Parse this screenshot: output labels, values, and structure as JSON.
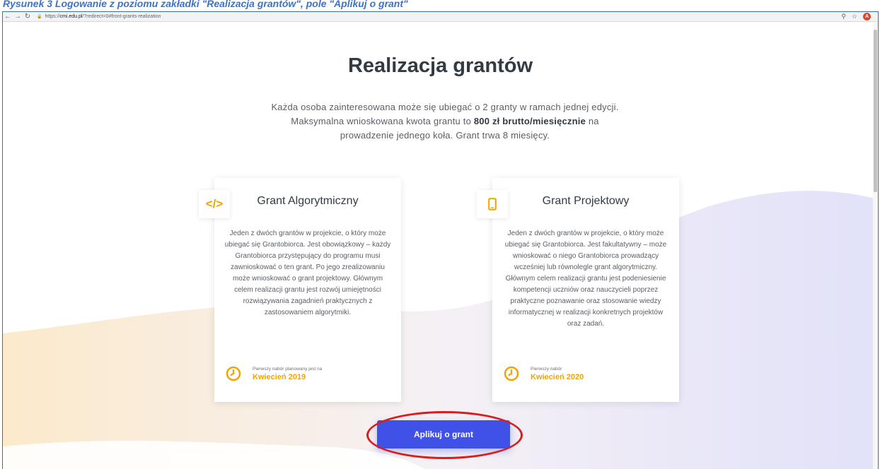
{
  "caption": "Rysunek 3 Logowanie z poziomu zakładki \"Realizacja grantów\", pole \"Aplikuj o grant\"",
  "browser": {
    "url_prefix": "https://",
    "url_domain": "cmi.edu.pl",
    "url_path": "/?redirect=0#front-grants-realization",
    "avatar_letter": "A"
  },
  "page": {
    "title": "Realizacja grantów",
    "intro_line1": "Każda osoba zainteresowana może się ubiegać o 2 granty w ramach jednej edycji.",
    "intro_line2_pre": "Maksymalna wnioskowana kwota grantu to ",
    "intro_line2_bold": "800 zł brutto/miesięcznie",
    "intro_line2_post": " na",
    "intro_line3": "prowadzenie jednego koła. Grant trwa 8 miesięcy."
  },
  "cards": [
    {
      "icon": "code-icon",
      "icon_glyph": "</>",
      "title": "Grant Algorytmiczny",
      "body": "Jeden z dwóch grantów w projekcie, o który może ubiegać się Grantobiorca. Jest obowiązkowy – każdy Grantobiorca przystępujący do programu musi zawnioskować o ten grant. Po jego zrealizowaniu może wnioskować o grant projektowy.  Głównym celem realizacji grantu jest rozwój umiejętności rozwiązywania zagadnień praktycznych z zastosowaniem algorytmiki.",
      "recruit_label": "Pierwszy nabór planowany jest na",
      "recruit_date": "Kwiecień 2019"
    },
    {
      "icon": "tablet-icon",
      "title": "Grant Projektowy",
      "body": "Jeden z dwóch grantów w projekcie, o który może ubiegać się Grantobiorca. Jest fakultatywny – może wnioskować o niego Grantobiorca prowadzący wcześniej lub równolegle grant algorytmiczny. Głównym celem realizacji grantu jest podeniesienie kompetencji uczniów oraz nauczycieli poprzez praktyczne poznawanie oraz stosowanie wiedzy informatycznej w realizacji konkretnych projektów oraz zadań.",
      "recruit_label": "Pierwszy nabór",
      "recruit_date": "Kwiecień 2020"
    }
  ],
  "apply_button": "Aplikuj o grant",
  "colors": {
    "accent": "#f0a400",
    "button": "#3f51e6",
    "highlight": "#d62020",
    "caption": "#3b74c5"
  }
}
